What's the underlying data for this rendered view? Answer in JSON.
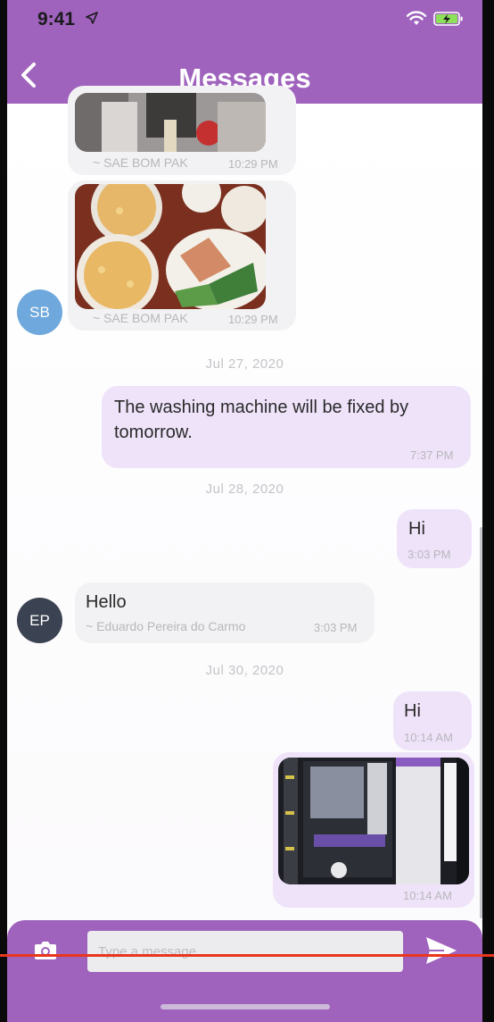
{
  "status_bar": {
    "time": "9:41"
  },
  "header": {
    "title": "Messages"
  },
  "conversation": {
    "photo_messages": [
      {
        "sender": "~ SAE BOM PAK",
        "time": "10:29 PM"
      },
      {
        "sender": "~ SAE BOM PAK",
        "time": "10:29 PM"
      }
    ],
    "avatars": {
      "sb": "SB",
      "ep": "EP"
    },
    "date_separators": [
      "Jul 27, 2020",
      "Jul 28, 2020",
      "Jul 30, 2020"
    ],
    "messages": [
      {
        "text": "The washing machine will be fixed by tomorrow.",
        "time": "7:37 PM"
      },
      {
        "text": "Hi",
        "time": "3:03 PM"
      },
      {
        "text": "Hello",
        "sender": "~ Eduardo Pereira do Carmo",
        "time": "3:03 PM"
      },
      {
        "text": "Hi",
        "time": "10:14 AM"
      }
    ],
    "last_photo": {
      "time": "10:14 AM"
    }
  },
  "composer": {
    "placeholder": "Type a message"
  },
  "colors": {
    "brand": "#9f63bd",
    "outgoing_bubble": "#efe3fa",
    "incoming_bubble": "#f2f2f4",
    "avatar_sb": "#6fa8dc",
    "avatar_ep": "#3b4252"
  },
  "icons": [
    "location-arrow-icon",
    "wifi-icon",
    "battery-charging-icon",
    "back-chevron-icon",
    "camera-icon",
    "send-icon"
  ]
}
